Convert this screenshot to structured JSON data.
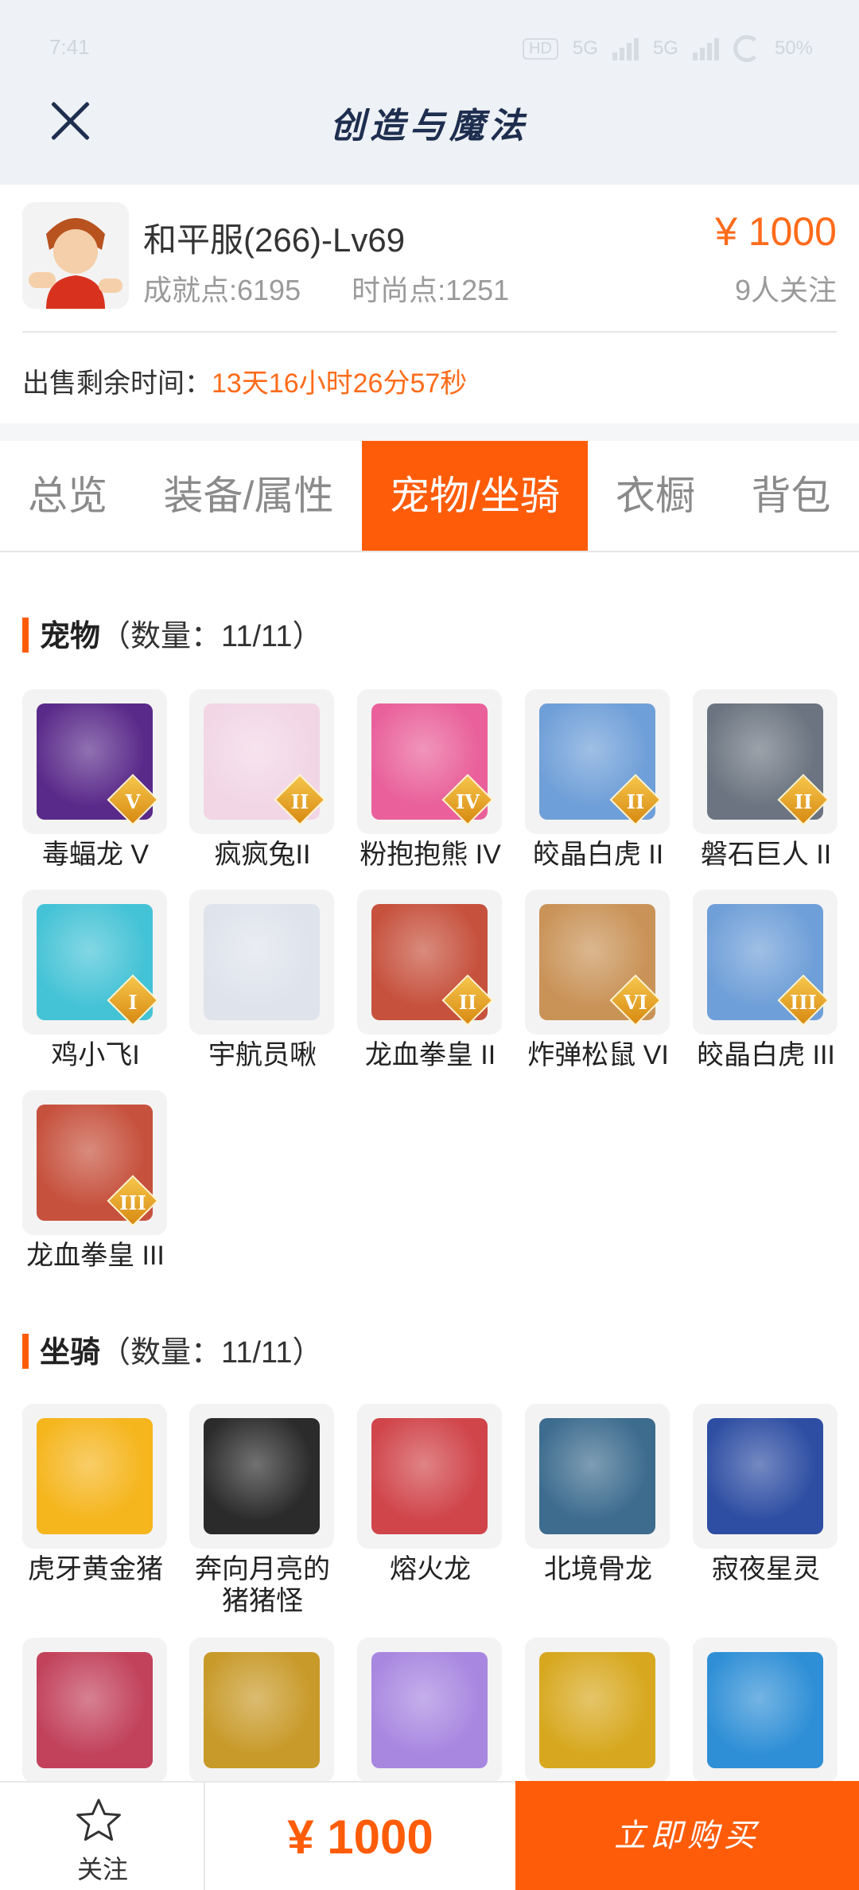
{
  "status_bar": {
    "time": "7:41",
    "hd": "HD",
    "signal1": "5G",
    "signal2": "5G",
    "battery": "50%"
  },
  "header": {
    "title": "创造与魔法"
  },
  "account": {
    "name": "和平服(266)-Lv69",
    "achievement": "成就点:6195",
    "fashion": "时尚点:1251",
    "price": "¥ 1000",
    "followers": "9人关注",
    "sale_label": "出售剩余时间：",
    "sale_remaining": "13天16小时26分57秒"
  },
  "tabs": [
    "总览",
    "装备/属性",
    "宠物/坐骑",
    "衣橱",
    "背包"
  ],
  "active_tab": 2,
  "pets": {
    "title": "宠物",
    "count": "（数量：11/11）",
    "items": [
      {
        "name": "毒蝠龙 V",
        "tier": "V",
        "color": "#5a2a8a"
      },
      {
        "name": "疯疯兔II",
        "tier": "II",
        "color": "#f2d6e6"
      },
      {
        "name": "粉抱抱熊 IV",
        "tier": "IV",
        "color": "#e9609a"
      },
      {
        "name": "皎晶白虎 II",
        "tier": "II",
        "color": "#6f9fd8"
      },
      {
        "name": "磐石巨人 II",
        "tier": "II",
        "color": "#6b7480"
      },
      {
        "name": "鸡小飞I",
        "tier": "I",
        "color": "#45c3d6"
      },
      {
        "name": "宇航员啾",
        "tier": "",
        "color": "#dfe3ec"
      },
      {
        "name": "龙血拳皇 II",
        "tier": "II",
        "color": "#c6513d"
      },
      {
        "name": "炸弹松鼠 VI",
        "tier": "VI",
        "color": "#c99358"
      },
      {
        "name": "皎晶白虎 III",
        "tier": "III",
        "color": "#6f9fd8"
      },
      {
        "name": "龙血拳皇 III",
        "tier": "III",
        "color": "#c6513d"
      }
    ]
  },
  "mounts": {
    "title": "坐骑",
    "count": "（数量：11/11）",
    "items": [
      {
        "name": "虎牙黄金猪",
        "color": "#f5b51c"
      },
      {
        "name": "奔向月亮的猪猪怪",
        "color": "#2b2b2b"
      },
      {
        "name": "熔火龙",
        "color": "#d0454a"
      },
      {
        "name": "北境骨龙",
        "color": "#3d6c8e"
      },
      {
        "name": "寂夜星灵",
        "color": "#2e4ea3"
      },
      {
        "name": "",
        "color": "#c2425c"
      },
      {
        "name": "",
        "color": "#c89a2a"
      },
      {
        "name": "",
        "color": "#a887e0"
      },
      {
        "name": "",
        "color": "#d7a81f"
      },
      {
        "name": "",
        "color": "#2f8fd6"
      }
    ]
  },
  "bottom": {
    "follow_label": "关注",
    "price": "¥ 1000",
    "buy_label": "立即购买"
  }
}
